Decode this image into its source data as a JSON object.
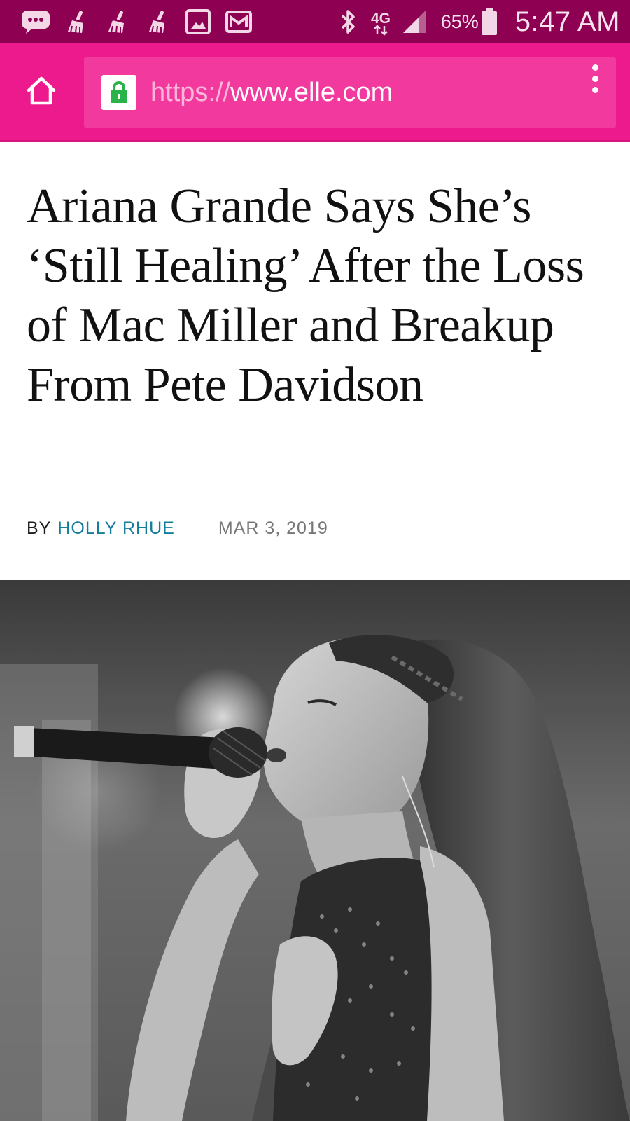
{
  "status_bar": {
    "battery_text": "65%",
    "time": "5:47 AM",
    "network_label": "4G",
    "notification_icons": [
      "sms-icon",
      "cleaner-icon",
      "cleaner-icon",
      "cleaner-icon",
      "image-icon",
      "mail-icon"
    ],
    "background_color": "#8e0052"
  },
  "toolbar": {
    "background_color": "#ec1a8c",
    "url_scheme": "https://",
    "url_host": "www.elle.com"
  },
  "article": {
    "title": "Ariana Grande Says She’s ‘Still Healing’ After the Loss of Mac Miller and Breakup From Pete Davidson",
    "by_prefix": "BY",
    "author": "HOLLY RHUE",
    "date": "MAR 3, 2019",
    "author_color": "#157c9c"
  },
  "hero_image": {
    "style": "black-and-white photograph"
  }
}
